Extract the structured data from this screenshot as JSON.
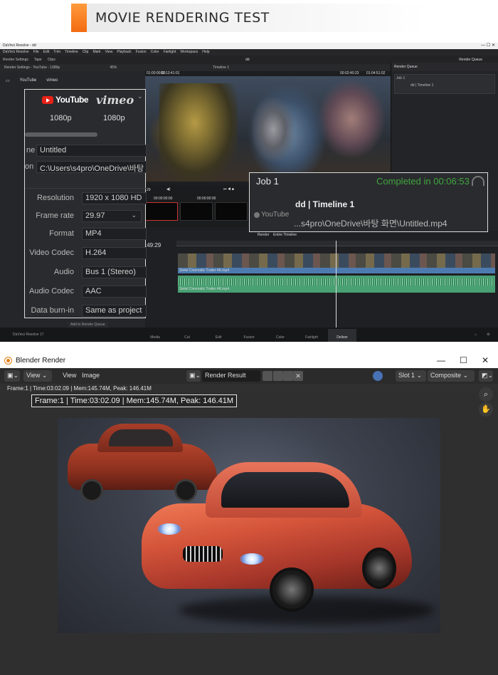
{
  "banner": {
    "title": "MOVIE RENDERING TEST"
  },
  "resolve": {
    "window_title": "DaVinci Resolve - dd",
    "menu": [
      "DaVinci Resolve",
      "File",
      "Edit",
      "Trim",
      "Timeline",
      "Clip",
      "Mark",
      "View",
      "Playback",
      "Fusion",
      "Color",
      "Fairlight",
      "Workspace",
      "Help"
    ],
    "toolbar": {
      "render_settings": "Render Settings",
      "tape": "Tape",
      "clips": "Clips",
      "project_name": "dd",
      "render_queue": "Render Queue"
    },
    "subbar": {
      "settings_title": "Render Settings - YouTube - 1080p",
      "zoom": "45%",
      "timeline_name": "Timeline 1",
      "timecode_left": "01:00:00:00",
      "timecode_mid": "01:13:41:01",
      "timecode_right": "00:02:40:23",
      "timecode_far": "01:04:51:02"
    },
    "render_queue": {
      "title": "Render Queue",
      "job_label": "Job 1",
      "job_name": "dd | Timeline 1"
    },
    "transport": {
      "timecode": "29",
      "clip1_tc": "00:00:00:00",
      "clip2_tc": "00:00:00:00"
    },
    "timeline": {
      "render_label": "Render",
      "render_scope": "Entire Timeline",
      "timecode": ":49:29",
      "track_label": "Sintel Cinematic Trailer 4K.mp4"
    },
    "pages": [
      "Media",
      "Cut",
      "Edit",
      "Fusion",
      "Color",
      "Fairlight",
      "Deliver"
    ],
    "active_page": "Deliver",
    "version": "DaVinci Resolve 17",
    "add_to_queue": "Add to Render Queue"
  },
  "zoom_settings": {
    "youtube_label": "YouTube",
    "vimeo_label": "vimeo",
    "youtube_res": "1080p",
    "vimeo_res": "1080p",
    "filename_label": "ne",
    "filename_value": "Untitled",
    "location_label": "on",
    "location_value": "C:\\Users\\s4pro\\OneDrive\\바탕",
    "rows": [
      {
        "label": "Resolution",
        "value": "1920 x 1080 HD"
      },
      {
        "label": "Frame rate",
        "value": "29.97"
      },
      {
        "label": "Format",
        "value": "MP4"
      },
      {
        "label": "Video Codec",
        "value": "H.264"
      },
      {
        "label": "Audio",
        "value": "Bus 1 (Stereo)"
      },
      {
        "label": "Audio Codec",
        "value": "AAC"
      },
      {
        "label": "Data burn-in",
        "value": "Same as project"
      }
    ]
  },
  "zoom_job": {
    "title": "Job 1",
    "status": "Completed in 00:06:53",
    "name": "dd | Timeline 1",
    "service": "YouTube",
    "path": "...s4pro\\OneDrive\\바탕 화면\\Untitled.mp4"
  },
  "blender": {
    "window_title": "Blender Render",
    "menu": {
      "view": "View",
      "view2": "View",
      "image": "Image"
    },
    "image_name": "Render Result",
    "slot": "Slot 1",
    "layer": "Composite",
    "stats": "Frame:1 | Time:03:02.09 | Mem:145.74M, Peak: 146.41M",
    "stats_zoom": "Frame:1 | Time:03:02.09 | Mem:145.74M, Peak: 146.41M"
  }
}
